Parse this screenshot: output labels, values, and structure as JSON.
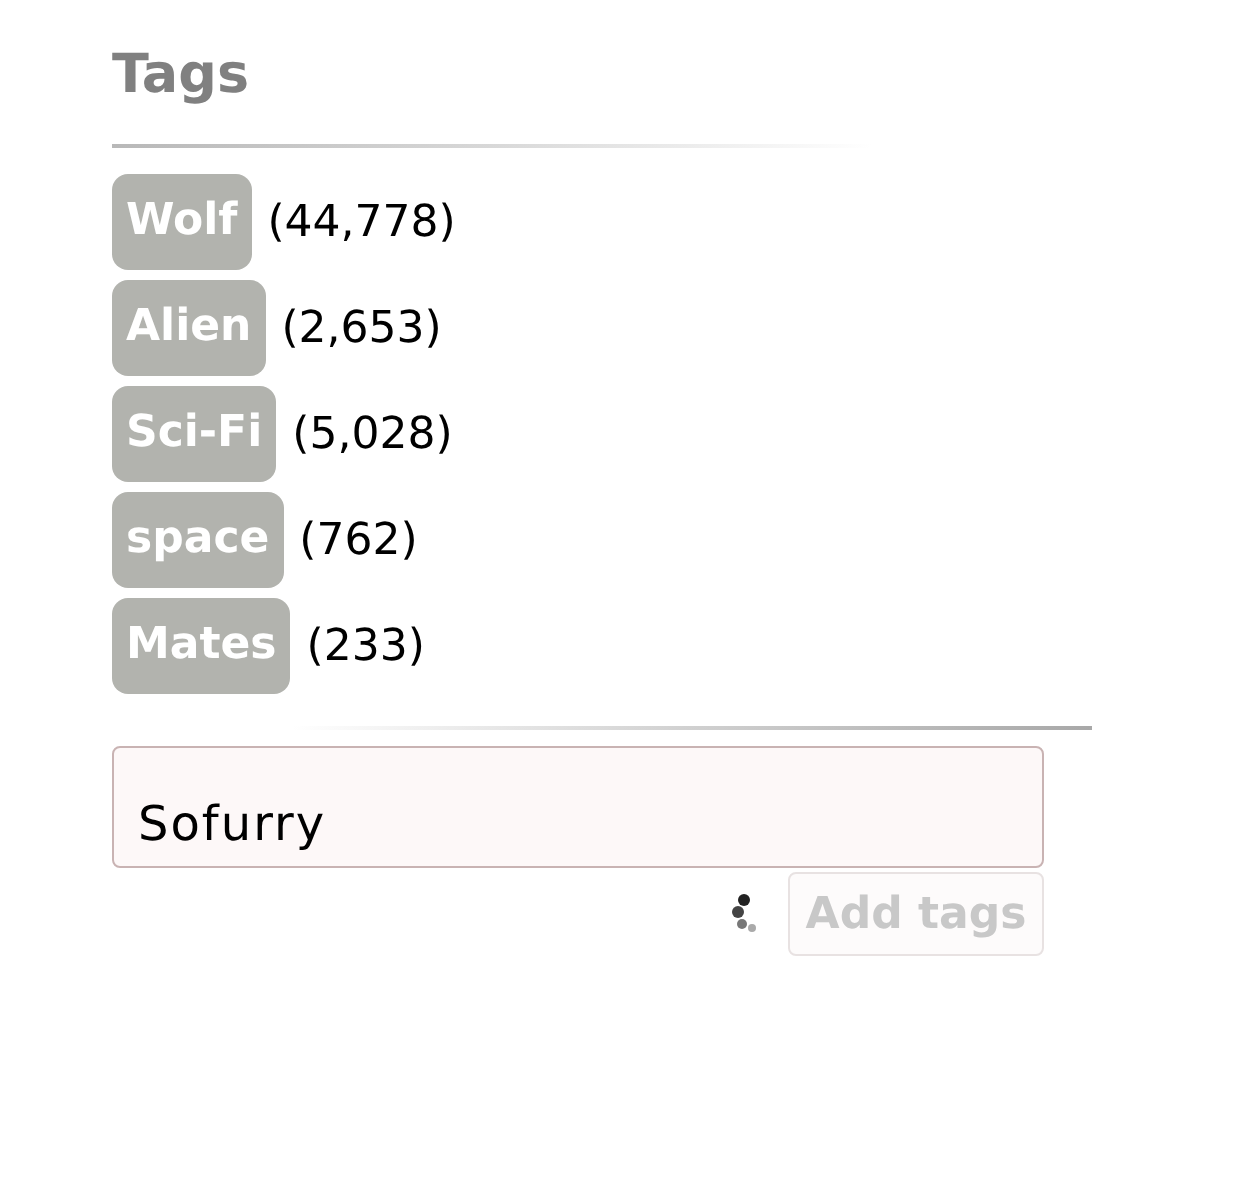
{
  "title": "Tags",
  "tags": [
    {
      "label": "Wolf",
      "count": "(44,778)"
    },
    {
      "label": "Alien",
      "count": "(2,653)"
    },
    {
      "label": "Sci-Fi",
      "count": "(5,028)"
    },
    {
      "label": "space",
      "count": "(762)"
    },
    {
      "label": "Mates",
      "count": "(233)"
    }
  ],
  "tag_input": {
    "value": "Sofurry"
  },
  "loading": true,
  "add_button": {
    "label": "Add tags",
    "disabled": true
  }
}
